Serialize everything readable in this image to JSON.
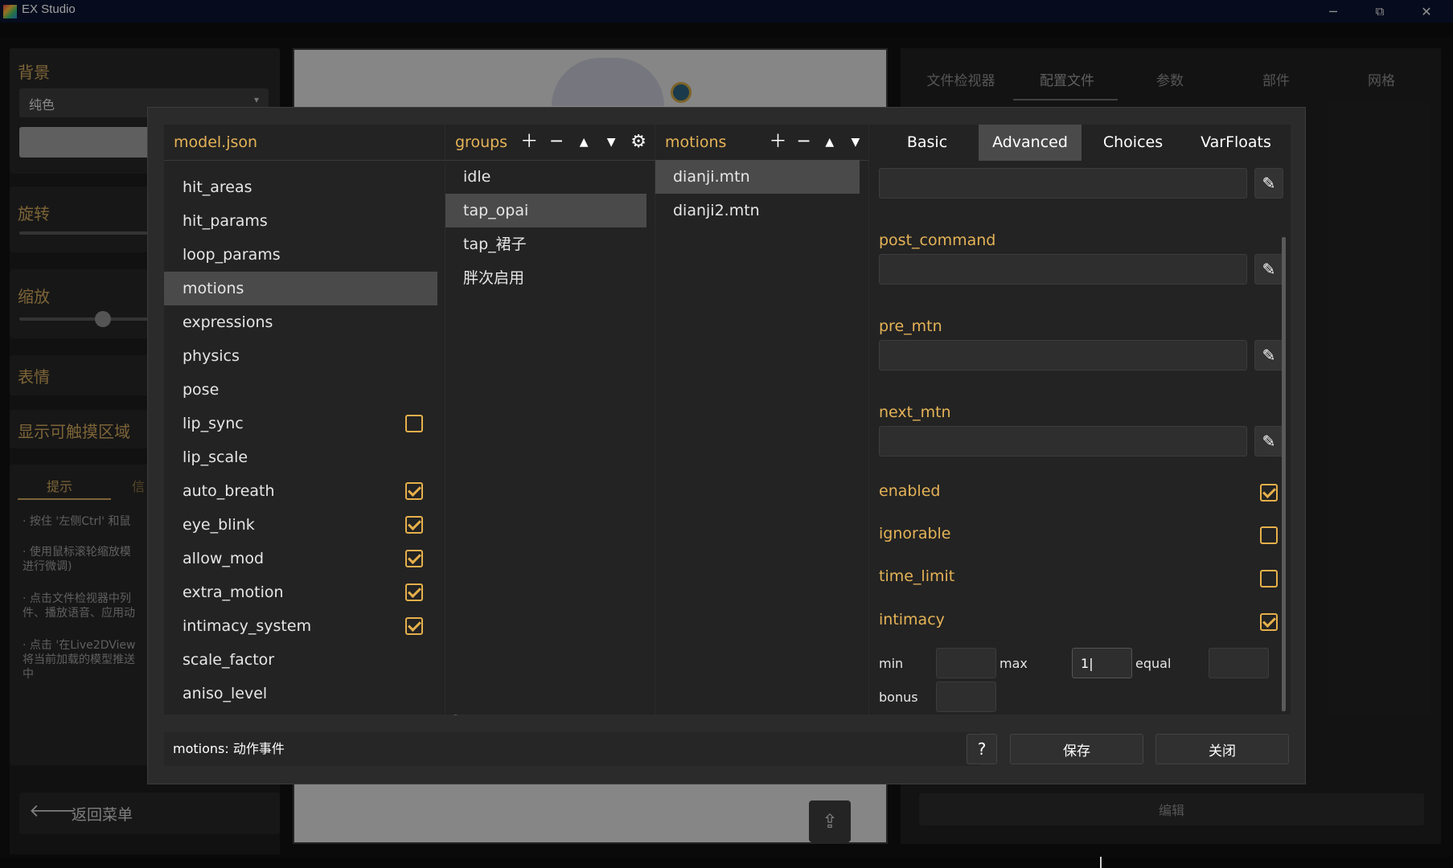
{
  "window": {
    "title": "EX Studio",
    "controls": {
      "minimize": "─",
      "maximize": "⧉",
      "close": "✕"
    }
  },
  "background": {
    "left_panel": {
      "bg_title": "背景",
      "bg_select": "纯色",
      "rotate_title": "旋转",
      "scale_title": "缩放",
      "expression_title": "表情",
      "touch_area_title": "显示可触摸区域",
      "tips_tab": "提示",
      "info_tab": "信",
      "tips": [
        "· 按住 '左侧Ctrl' 和鼠",
        "· 使用鼠标滚轮缩放模\n进行微调)",
        "· 点击文件检视器中列\n件、播放语音、应用动",
        "· 点击 '在Live2DView\n将当前加载的模型推送\n中"
      ],
      "back_label": "返回菜单"
    },
    "right_panel": {
      "tabs": [
        "文件检视器",
        "配置文件",
        "参数",
        "部件",
        "网格"
      ],
      "edit_label": "编辑"
    }
  },
  "dialog": {
    "tree": {
      "header": "model.json",
      "items": [
        {
          "label": "hit_areas"
        },
        {
          "label": "hit_params"
        },
        {
          "label": "loop_params"
        },
        {
          "label": "motions",
          "selected": true
        },
        {
          "label": "expressions"
        },
        {
          "label": "physics"
        },
        {
          "label": "pose"
        },
        {
          "label": "lip_sync",
          "checkbox": false
        },
        {
          "label": "lip_scale"
        },
        {
          "label": "auto_breath",
          "checkbox": true
        },
        {
          "label": "eye_blink",
          "checkbox": true
        },
        {
          "label": "allow_mod",
          "checkbox": true
        },
        {
          "label": "extra_motion",
          "checkbox": true
        },
        {
          "label": "intimacy_system",
          "checkbox": true
        },
        {
          "label": "scale_factor"
        },
        {
          "label": "aniso_level"
        }
      ]
    },
    "groups": {
      "header": "groups",
      "items": [
        "idle",
        "tap_opai",
        "tap_裙子",
        "胖次启用"
      ],
      "selected_index": 1
    },
    "motions": {
      "header": "motions",
      "items": [
        "dianji.mtn",
        "dianji2.mtn"
      ],
      "selected_index": 0
    },
    "detail": {
      "tabs": [
        "Basic",
        "Advanced",
        "Choices",
        "VarFloats"
      ],
      "active_tab": "Advanced",
      "text_fields": [
        {
          "label": "post_command",
          "value": ""
        },
        {
          "label": "pre_mtn",
          "value": ""
        },
        {
          "label": "next_mtn",
          "value": ""
        }
      ],
      "checks": [
        {
          "label": "enabled",
          "checked": true
        },
        {
          "label": "ignorable",
          "checked": false
        },
        {
          "label": "time_limit",
          "checked": false
        },
        {
          "label": "intimacy",
          "checked": true
        }
      ],
      "intimacy": {
        "min_label": "min",
        "min_value": "",
        "max_label": "max",
        "max_value": "1",
        "equal_label": "equal",
        "equal_value": "",
        "bonus_label": "bonus",
        "bonus_value": ""
      }
    },
    "status_text": "motions: 动作事件",
    "help_label": "?",
    "save_label": "保存",
    "close_label": "关闭"
  }
}
